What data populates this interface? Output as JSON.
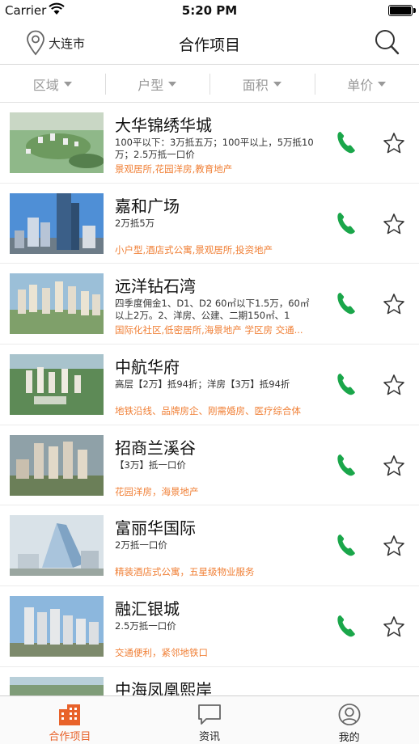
{
  "status_bar": {
    "carrier": "Carrier",
    "time": "5:20 PM"
  },
  "nav": {
    "city": "大连市",
    "title": "合作项目"
  },
  "filters": [
    {
      "label": "区域"
    },
    {
      "label": "户型"
    },
    {
      "label": "面积"
    },
    {
      "label": "单价"
    }
  ],
  "colors": {
    "accent": "#f07f35",
    "phone": "#1aa64a",
    "tab_active": "#e8622a"
  },
  "projects": [
    {
      "name": "大华锦绣华城",
      "desc": "100平以下：3万抵五万；100平以上，5万抵10万；2.5万抵一口价",
      "tags": "景观居所,花园洋房,教育地产"
    },
    {
      "name": "嘉和广场",
      "desc": "2万抵5万",
      "tags": "小户型,酒店式公寓,景观居所,投资地产"
    },
    {
      "name": "远洋钻石湾",
      "desc": "四季度佣金1、D1、D2 60㎡以下1.5万，60㎡以上2万。2、洋房、公建、二期150㎡、1",
      "tags": "国际化社区,低密居所,海景地产 学区房 交通..."
    },
    {
      "name": "中航华府",
      "desc": "高层【2万】抵94折；洋房【3万】抵94折",
      "tags": "地铁沿线、品牌房企、刚需婚房、医疗综合体"
    },
    {
      "name": "招商兰溪谷",
      "desc": "【3万】抵一口价",
      "tags": "花园洋房，海景地产"
    },
    {
      "name": "富丽华国际",
      "desc": "2万抵一口价",
      "tags": "精装酒店式公寓，五星级物业服务"
    },
    {
      "name": "融汇银城",
      "desc": "2.5万抵一口价",
      "tags": "交通便利，紧邻地铁口"
    },
    {
      "name": "中海凤凰熙岸",
      "desc": "",
      "tags": ""
    }
  ],
  "tabs": [
    {
      "label": "合作项目",
      "icon": "building-icon"
    },
    {
      "label": "资讯",
      "icon": "chat-bubble-icon"
    },
    {
      "label": "我的",
      "icon": "user-icon"
    }
  ]
}
